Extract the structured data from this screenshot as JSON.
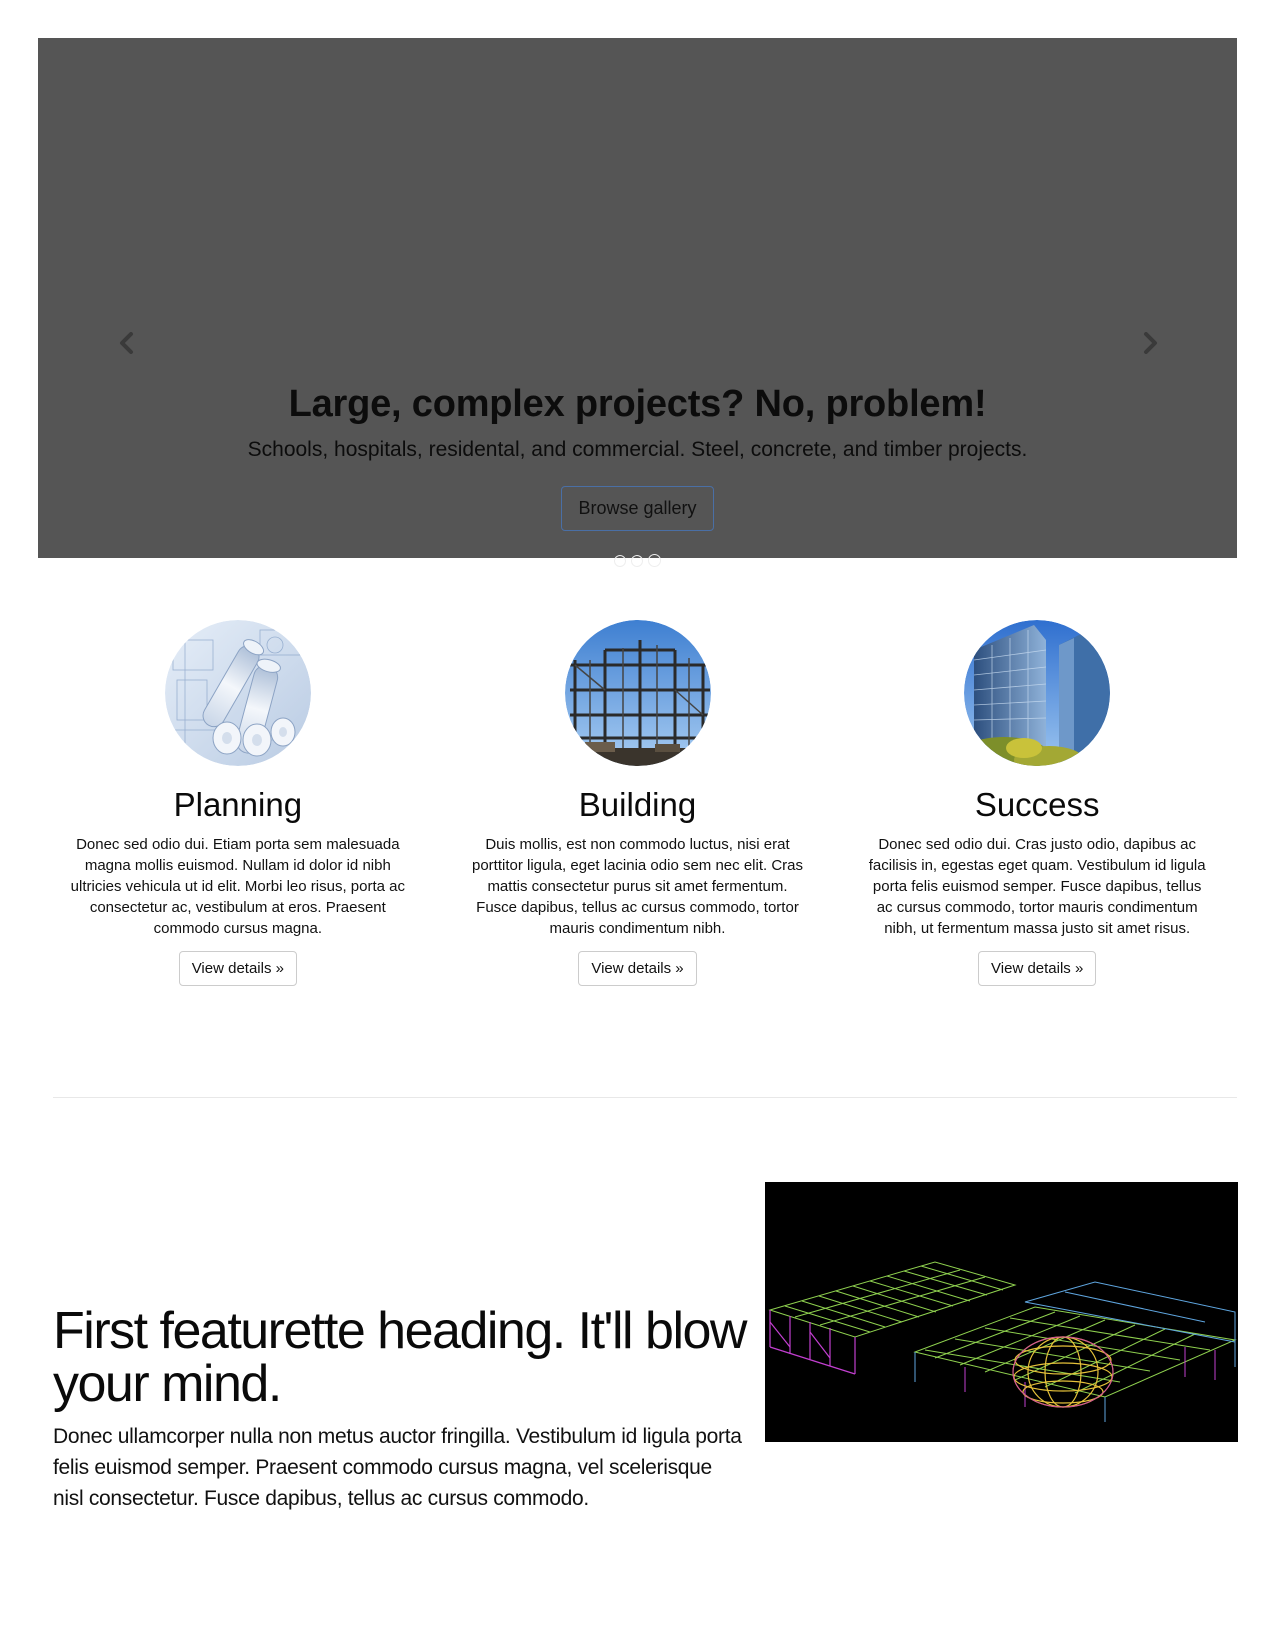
{
  "carousel": {
    "heading": "Large, complex projects? No, problem!",
    "subheading": "Schools, hospitals, residental, and commercial. Steel, concrete, and timber projects.",
    "button_label": "Browse gallery",
    "prev_icon": "chevron-left-icon",
    "next_icon": "chevron-right-icon",
    "slide_count": 3,
    "background_color": "#555555"
  },
  "columns": [
    {
      "title": "Planning",
      "text": "Donec sed odio dui. Etiam porta sem malesuada magna mollis euismod. Nullam id dolor id nibh ultricies vehicula ut id elit. Morbi leo risus, porta ac consectetur ac, vestibulum at eros. Praesent commodo cursus magna.",
      "button_label": "View details »",
      "image": "blueprints-image"
    },
    {
      "title": "Building",
      "text": "Duis mollis, est non commodo luctus, nisi erat porttitor ligula, eget lacinia odio sem nec elit. Cras mattis consectetur purus sit amet fermentum. Fusce dapibus, tellus ac cursus commodo, tortor mauris condimentum nibh.",
      "button_label": "View details »",
      "image": "steel-frame-image"
    },
    {
      "title": "Success",
      "text": "Donec sed odio dui. Cras justo odio, dapibus ac facilisis in, egestas eget quam. Vestibulum id ligula porta felis euismod semper. Fusce dapibus, tellus ac cursus commodo, tortor mauris condimentum nibh, ut fermentum massa justo sit amet risus.",
      "button_label": "View details »",
      "image": "skyscraper-image"
    }
  ],
  "featurette": {
    "heading": "First featurette heading. It'll blow your mind.",
    "text": "Donec ullamcorper nulla non metus auctor fringilla. Vestibulum id ligula porta felis euismod semper. Praesent commodo cursus magna, vel scelerisque nisl consectetur. Fusce dapibus, tellus ac cursus commodo.",
    "image": "structural-wireframe-image"
  }
}
